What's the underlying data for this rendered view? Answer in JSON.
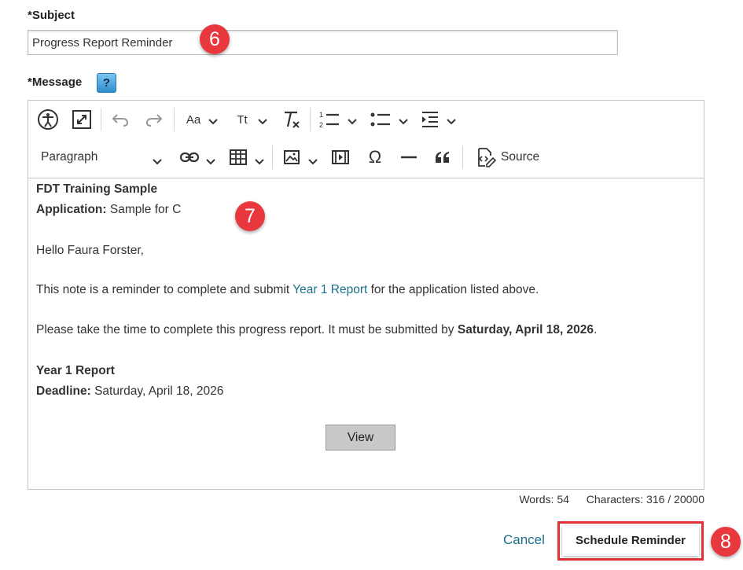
{
  "subject": {
    "label": "*Subject",
    "value": "Progress Report Reminder"
  },
  "message": {
    "label": "*Message",
    "help_glyph": "?"
  },
  "toolbar": {
    "paragraph_select": "Paragraph",
    "source_label": "Source",
    "font_family_glyph": "Aa",
    "font_size_glyph": "Tt",
    "icons": [
      "accessibility-icon",
      "fullscreen-icon",
      "undo-icon",
      "redo-icon",
      "font-family-icon",
      "font-size-icon",
      "remove-format-icon",
      "numbered-list-icon",
      "bulleted-list-icon",
      "indent-icon",
      "link-icon",
      "table-icon",
      "image-icon",
      "media-icon",
      "special-character-icon",
      "horizontal-line-icon",
      "blockquote-icon",
      "source-icon"
    ]
  },
  "content": {
    "title": "FDT Training Sample",
    "application_label": "Application:",
    "application_value": " Sample for C",
    "greeting": "Hello Faura Forster,",
    "reminder_pre": "This note is a reminder to complete and submit ",
    "reminder_link": "Year 1 Report",
    "reminder_post": " for the application listed above.",
    "please_pre": "Please take the time to complete this progress report. It must be submitted by ",
    "please_date": "Saturday, April 18, 2026",
    "please_post": ".",
    "report_title": "Year 1 Report",
    "deadline_label": "Deadline:",
    "deadline_value": " Saturday, April 18, 2026",
    "view_button": "View"
  },
  "counts": {
    "words": "Words: 54",
    "characters": "Characters: 316 / 20000"
  },
  "actions": {
    "cancel": "Cancel",
    "schedule": "Schedule Reminder"
  },
  "callouts": {
    "six": "6",
    "seven": "7",
    "eight": "8"
  },
  "colors": {
    "callout": "#e8383d",
    "highlight_border": "#e03137",
    "link": "#1a6f8a"
  }
}
